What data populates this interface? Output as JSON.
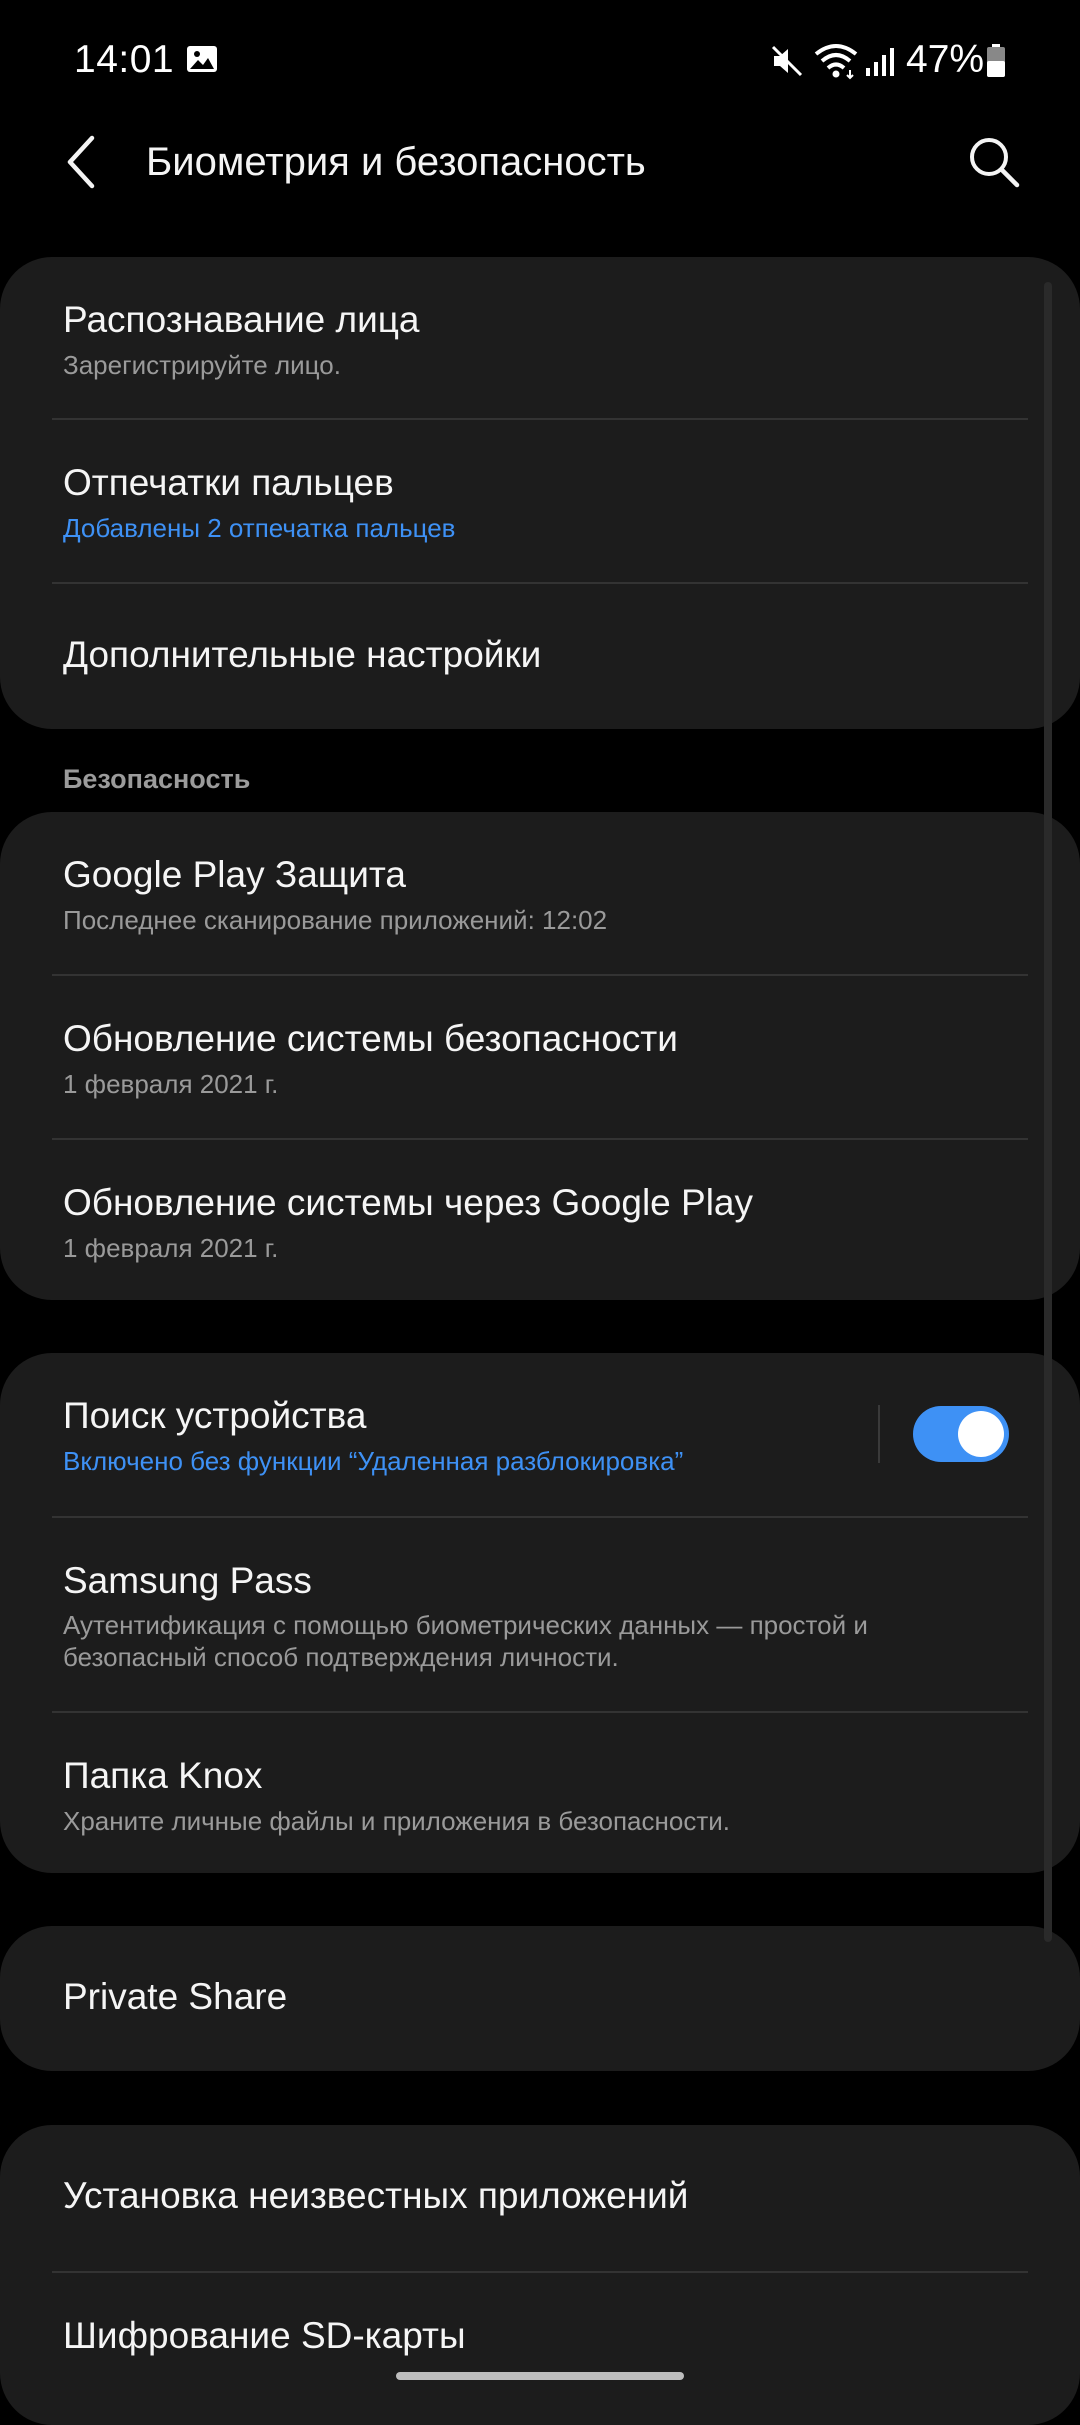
{
  "status_bar": {
    "time": "14:01",
    "battery": "47%",
    "icons": [
      "gallery-icon",
      "mute-icon",
      "wifi-icon",
      "signal-icon",
      "battery-icon"
    ]
  },
  "app_bar": {
    "title": "Биометрия и безопасность",
    "icons": [
      "back-arrow-icon",
      "search-icon"
    ]
  },
  "biometrics": {
    "face": {
      "title": "Распознавание лица",
      "subtitle": "Зарегистрируйте лицо."
    },
    "fingerprints": {
      "title": "Отпечатки пальцев",
      "subtitle": "Добавлены 2 отпечатка пальцев"
    },
    "more": {
      "title": "Дополнительные настройки"
    }
  },
  "security": {
    "header": "Безопасность",
    "play_protect": {
      "title": "Google Play Защита",
      "subtitle": "Последнее сканирование приложений: 12:02"
    },
    "security_update": {
      "title": "Обновление системы безопасности",
      "subtitle": "1 февраля 2021 г."
    },
    "play_update": {
      "title": "Обновление системы через Google Play",
      "subtitle": "1 февраля 2021 г."
    }
  },
  "device": {
    "find_device": {
      "title": "Поиск устройства",
      "subtitle": "Включено без функции “Удаленная разблокировка”",
      "enabled": true
    },
    "samsung_pass": {
      "title": "Samsung Pass",
      "subtitle": "Аутентификация с помощью биометрических данных — простой и безопасный способ подтверждения личности."
    },
    "knox": {
      "title": "Папка Knox",
      "subtitle": "Храните личные файлы и приложения в безопасности."
    }
  },
  "private_share": {
    "title": "Private Share"
  },
  "other": {
    "unknown_apps": {
      "title": "Установка неизвестных приложений"
    },
    "sd_encryption": {
      "title": "Шифрование SD-карты"
    }
  },
  "colors": {
    "accent": "#3e91f5",
    "card": "#1c1c1c",
    "background": "#000000"
  }
}
